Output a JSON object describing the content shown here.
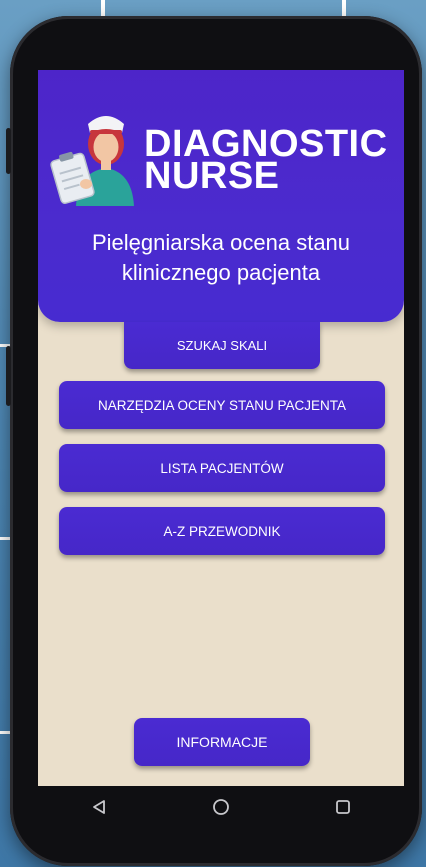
{
  "app": {
    "title_line1": "DIAGNOSTIC",
    "title_line2": "NURSE",
    "subtitle_line1": "Pielęgniarska ocena stanu",
    "subtitle_line2": "klinicznego pacjenta"
  },
  "menu": {
    "search_scale": "SZUKAJ SKALI",
    "assessment_tools": "NARZĘDZIA OCENY STANU PACJENTA",
    "patient_list": "LISTA PACJENTÓW",
    "az_guide": "A-Z PRZEWODNIK",
    "info": "INFORMACJE"
  },
  "navbar": {
    "icons": [
      "back-triangle-icon",
      "home-circle-icon",
      "recents-square-icon"
    ]
  },
  "colors": {
    "header": "#4b2bce",
    "button": "#4828cc",
    "screen_background": "#eadfcb",
    "phone_frame": "#0f0f12",
    "backdrop": "#4f88b4"
  }
}
